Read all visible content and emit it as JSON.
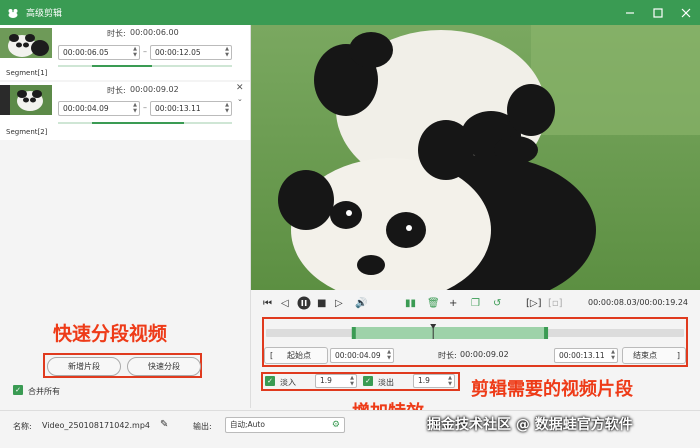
{
  "window": {
    "title": "高级剪辑",
    "minimize_icon": "minimize-icon",
    "maximize_icon": "maximize-icon",
    "close_icon": "close-icon"
  },
  "segments": [
    {
      "label": "Segment[1]",
      "duration_label": "时长:",
      "duration": "00:00:06.00",
      "start": "00:00:06.05",
      "end": "00:00:12.05"
    },
    {
      "label": "Segment[2]",
      "duration_label": "时长:",
      "duration": "00:00:09.02",
      "start": "00:00:04.09",
      "end": "00:00:13.11"
    }
  ],
  "left_actions": {
    "add_segment": "新增片段",
    "quick_split": "快速分段",
    "merge_all": "合并所有",
    "merge_all_checked": true
  },
  "annotations": {
    "quick_split_video": "快速分段视频",
    "clip_needed": "剪辑需要的视频片段",
    "add_effects": "增加特效"
  },
  "player": {
    "timecode": "00:00:08.03/00:00:19.24"
  },
  "points": {
    "start_btn": "起始点",
    "start_value": "00:00:04.09",
    "duration_label": "时长:",
    "duration_value": "00:00:09.02",
    "end_value": "00:00:13.11",
    "end_btn": "结束点",
    "bracket_left": "[",
    "bracket_right": "]"
  },
  "effects": {
    "fade_in_label": "淡入",
    "fade_in_value": "1.9",
    "fade_out_label": "淡出",
    "fade_out_value": "1.9"
  },
  "output": {
    "name_label": "名称:",
    "file_name": "Video_250108171042.mp4",
    "output_label": "输出:",
    "output_value": "自动;Auto"
  },
  "watermark": "掘金技术社区 @ 数据蛙官方软件",
  "timeline": {
    "selection_start_fraction": 0.21,
    "selection_end_fraction": 0.67,
    "playhead_fraction": 0.4
  },
  "colors": {
    "brand_green": "#3a9b53",
    "annotation_red": "#ee3b18"
  }
}
